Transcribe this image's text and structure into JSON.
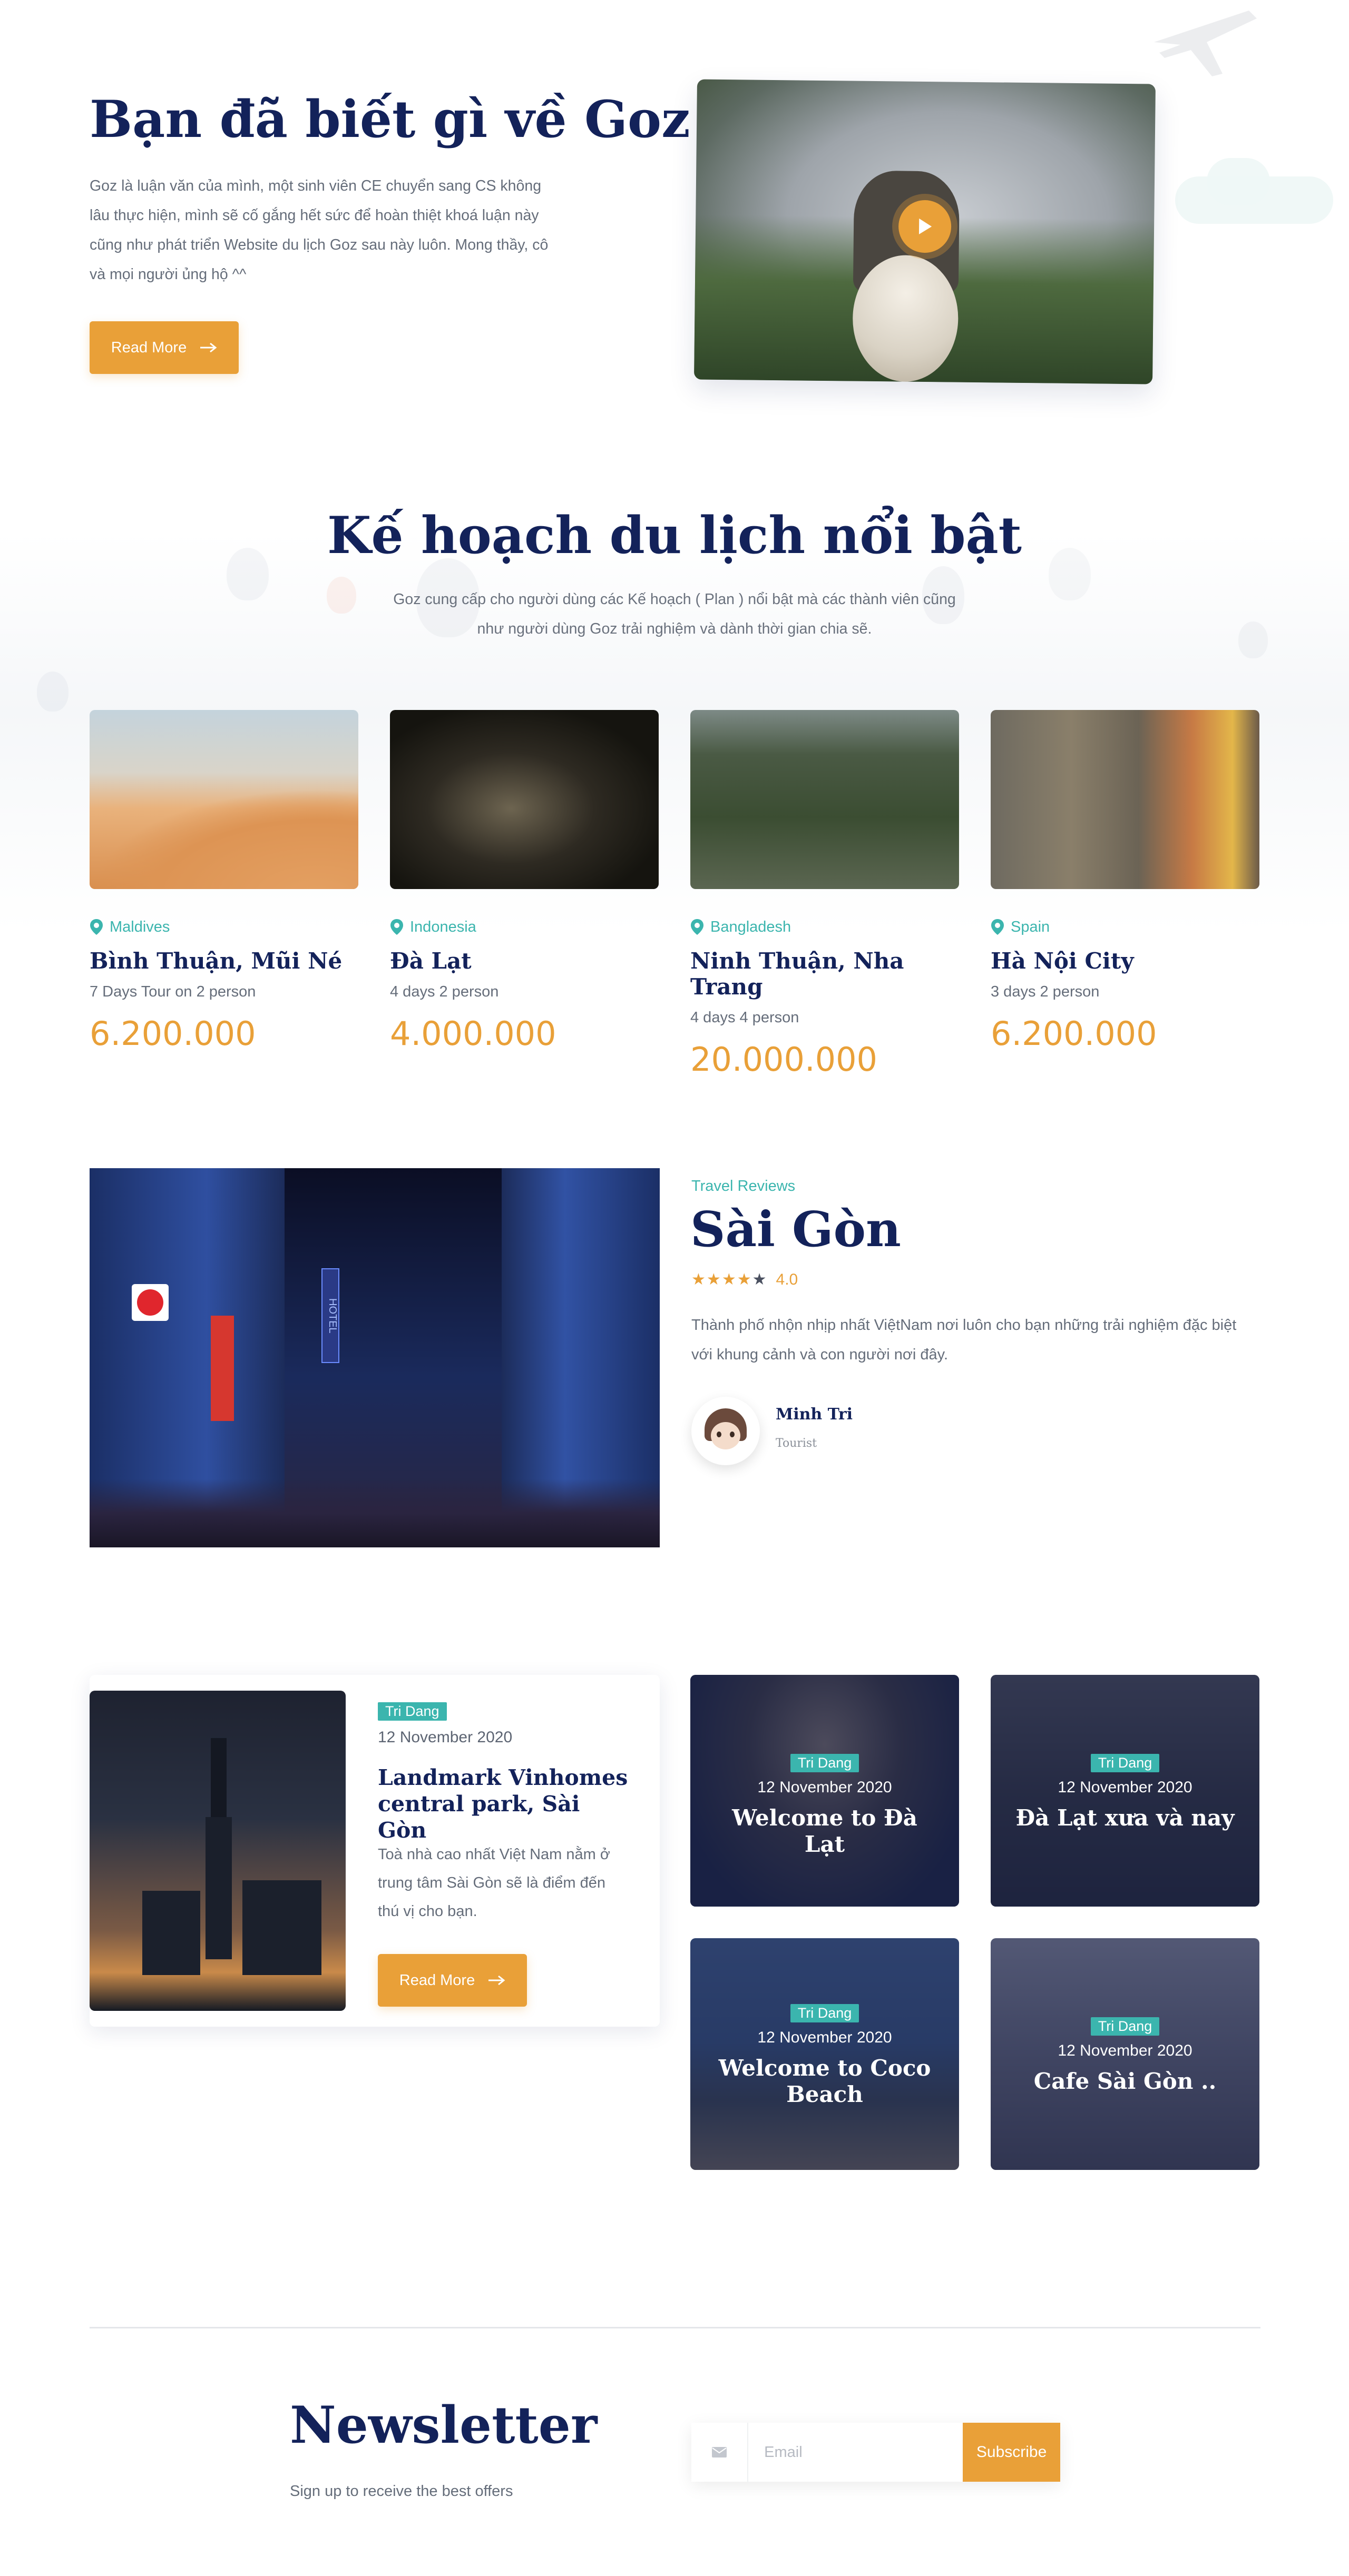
{
  "hero": {
    "title": "Bạn đã biết gì về Goz",
    "text": "Goz là luận văn của mình, một sinh viên CE chuyển sang CS không lâu thực hiện, mình sẽ cố gắng hết sức để hoàn thiệt khoá luận này cũng như phát triển Website du lịch Goz sau này luôn. Mong thầy, cô và mọi người ủng hộ ^^",
    "button_label": "Read More"
  },
  "plans": {
    "title": "Kế hoạch du lịch nổi bật",
    "subtitle": "Goz cung cấp cho người dùng các Kế hoạch ( Plan ) nổi bật mà các thành viên cũng như người dùng Goz trải nghiệm và dành thời gian chia sẽ.",
    "items": [
      {
        "location": "Maldives",
        "name": "Bình Thuận, Mũi Né",
        "duration": "7 Days Tour on 2 person",
        "price": "6.200.000"
      },
      {
        "location": "Indonesia",
        "name": "Đà Lạt",
        "duration": "4 days 2 person",
        "price": "4.000.000"
      },
      {
        "location": "Bangladesh",
        "name": "Ninh Thuận, Nha Trang",
        "duration": "4 days 4 person",
        "price": "20.000.000"
      },
      {
        "location": "Spain",
        "name": "Hà Nội City",
        "duration": "3 days 2 person",
        "price": "6.200.000"
      }
    ]
  },
  "review": {
    "tag": "Travel Reviews",
    "title": "Sài Gòn",
    "rating": "4.0",
    "rating_value": 4,
    "text": "Thành phố nhộn nhịp nhất ViệtNam nơi luôn cho bạn những trải nghiệm đặc biệt với khung cảnh và con người nơi đây.",
    "author": "Minh Tri",
    "role": "Tourist",
    "sign_text": "HOTEL"
  },
  "blog": {
    "featured": {
      "tag": "Tri Dang",
      "date": "12 November 2020",
      "title": "Landmark Vinhomes central park, Sài Gòn",
      "text": "Toà nhà cao nhất Việt Nam nằm ở trung tâm Sài Gòn sẽ là điểm đến thú vị cho bạn.",
      "button_label": "Read More"
    },
    "posts": [
      {
        "tag": "Tri Dang",
        "date": "12 November 2020",
        "title": "Welcome to Đà Lạt"
      },
      {
        "tag": "Tri Dang",
        "date": "12 November 2020",
        "title": "Đà Lạt xưa và nay"
      },
      {
        "tag": "Tri Dang",
        "date": "12 November 2020",
        "title": "Welcome to Coco Beach"
      },
      {
        "tag": "Tri Dang",
        "date": "12 November 2020",
        "title": "Cafe Sài Gòn .."
      }
    ]
  },
  "newsletter": {
    "title": "Newsletter",
    "subtitle": "Sign up to receive the best offers",
    "placeholder": "Email",
    "button_label": "Subscribe"
  },
  "colors": {
    "accent": "#e9a038",
    "teal": "#3bb5ae",
    "navy": "#13225a"
  },
  "icons": [
    "play-icon",
    "arrow-right-icon",
    "map-pin-icon",
    "star-icon",
    "mail-icon",
    "airplane-icon"
  ]
}
